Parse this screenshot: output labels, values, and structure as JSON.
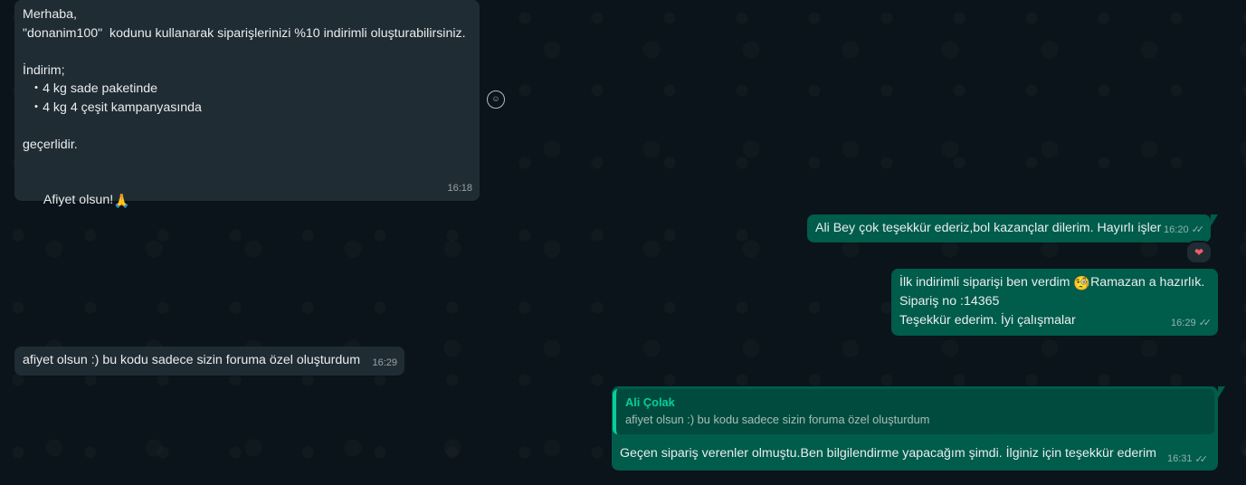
{
  "messages": {
    "m1": {
      "lines": [
        "Merhaba,",
        "\"donanim100\"  kodunu kullanarak siparişlerinizi %10 indirimli oluşturabilirsiniz.",
        "",
        "İndirim;",
        "  ・4 kg sade paketinde",
        "  ・4 kg 4 çeşit kampanyasında",
        "",
        "geçerlidir.",
        ""
      ],
      "last_line": "Afiyet olsun!",
      "last_emoji": "🙏",
      "time": "16:18"
    },
    "m2": {
      "text": "Ali Bey çok teşekkür ederiz,bol kazançlar dilerim. Hayırlı işler",
      "time": "16:20",
      "reaction": "❤"
    },
    "m3": {
      "line1_a": "İlk indirimli siparişi ben verdim ",
      "line1_emoji": "🧐",
      "line1_b": "Ramazan a hazırlık.",
      "line2": "Sipariş no :14365",
      "line3": "Teşekkür ederim. İyi çalışmalar",
      "time": "16:29"
    },
    "m4": {
      "text": "afiyet olsun :) bu kodu sadece sizin foruma özel oluşturdum",
      "time": "16:29"
    },
    "m5": {
      "quote_author": "Ali Çolak",
      "quote_text": "afiyet olsun :) bu kodu sadece sizin foruma özel oluşturdum",
      "text": "Geçen sipariş verenler olmuştu.Ben bilgilendirme yapacağım şimdi. İlginiz için teşekkür ederim",
      "time": "16:31"
    }
  },
  "icons": {
    "ticks": "✓✓",
    "smiley": "☺"
  },
  "colors": {
    "background": "#0b141a",
    "incoming": "#202c33",
    "outgoing": "#005c4b",
    "quote_accent": "#06cf9c"
  }
}
